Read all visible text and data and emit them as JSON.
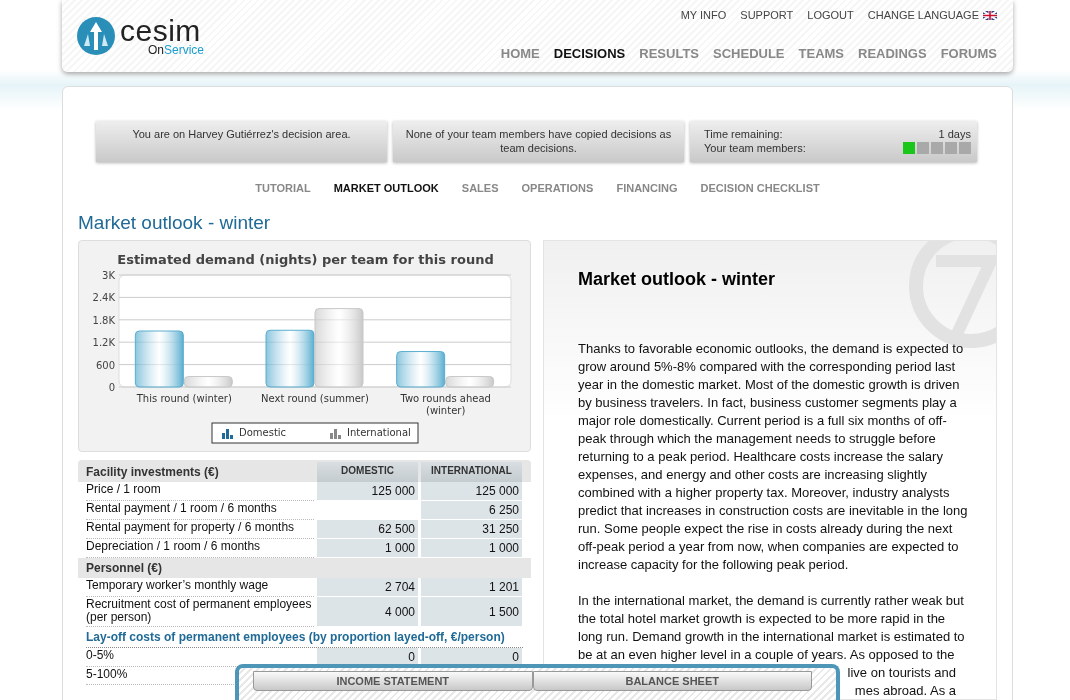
{
  "logo": {
    "name": "cesim",
    "sub_prefix": "On",
    "sub_suffix": "Service"
  },
  "top_links": [
    {
      "label": "MY INFO"
    },
    {
      "label": "SUPPORT"
    },
    {
      "label": "LOGOUT"
    },
    {
      "label": "CHANGE LANGUAGE",
      "flag": true
    }
  ],
  "main_nav": [
    {
      "label": "HOME",
      "selected": false
    },
    {
      "label": "DECISIONS",
      "selected": true
    },
    {
      "label": "RESULTS",
      "selected": false
    },
    {
      "label": "SCHEDULE",
      "selected": false
    },
    {
      "label": "TEAMS",
      "selected": false
    },
    {
      "label": "READINGS",
      "selected": false
    },
    {
      "label": "FORUMS",
      "selected": false
    }
  ],
  "info_boxes": [
    {
      "kind": "text",
      "text": "You are on Harvey Gutiérrez's decision area."
    },
    {
      "kind": "text",
      "text": "None of your team members have copied decisions as team decisions."
    },
    {
      "kind": "status",
      "time_label": "Time remaining:",
      "time_value": "1 days",
      "members_label": "Your team members:",
      "members": [
        {
          "online": true
        },
        {
          "online": false
        },
        {
          "online": false
        },
        {
          "online": false
        },
        {
          "online": false
        }
      ]
    }
  ],
  "sub_nav": [
    {
      "label": "TUTORIAL",
      "selected": false
    },
    {
      "label": "MARKET OUTLOOK",
      "selected": true
    },
    {
      "label": "SALES",
      "selected": false
    },
    {
      "label": "OPERATIONS",
      "selected": false
    },
    {
      "label": "FINANCING",
      "selected": false
    },
    {
      "label": "DECISION CHECKLIST",
      "selected": false
    }
  ],
  "page_title": "Market outlook - winter",
  "chart": {
    "chart_data": {
      "type": "bar",
      "title": "Estimated demand (nights) per team for this round",
      "categories": [
        "This round (winter)",
        "Next round (summer)",
        "Two rounds ahead (winter)"
      ],
      "series": [
        {
          "name": "Domestic",
          "color": "#5aaed0",
          "values": [
            1500,
            1520,
            950
          ]
        },
        {
          "name": "International",
          "color": "#c8c8c8",
          "values": [
            280,
            2100,
            280
          ]
        }
      ],
      "grid": true,
      "legend": true,
      "ylim": [
        0,
        3000
      ],
      "yticks": [
        {
          "value": 0,
          "label": "0"
        },
        {
          "value": 600,
          "label": "600"
        },
        {
          "value": 1200,
          "label": "1.2K"
        },
        {
          "value": 1800,
          "label": "1.8K"
        },
        {
          "value": 2400,
          "label": "2.4K"
        },
        {
          "value": 3000,
          "label": "3K"
        }
      ]
    }
  },
  "table": {
    "columns": [
      "DOMESTIC",
      "INTERNATIONAL"
    ],
    "sections": [
      {
        "kind": "group",
        "title": "Facility investments (€)",
        "header": true,
        "rows": [
          {
            "label": "Price / 1 room",
            "domestic": "125 000",
            "international": "125 000"
          },
          {
            "label": "Rental payment / 1 room / 6 months",
            "international": "6 250"
          },
          {
            "label": "Rental payment for property / 6 months",
            "domestic": "62 500",
            "international": "31 250"
          },
          {
            "label": "Depreciation / 1 room / 6 months",
            "domestic": "1 000",
            "international": "1 000"
          }
        ]
      },
      {
        "kind": "group",
        "title": "Personnel (€)",
        "rows": [
          {
            "label": "Temporary worker’s monthly wage",
            "domestic": "2 704",
            "international": "1 201"
          },
          {
            "label": "Recruitment cost of permanent employees (per person)",
            "domestic": "4 000",
            "international": "1 500"
          }
        ]
      },
      {
        "kind": "subgroup",
        "title": "Lay-off costs of permanent employees (by proportion layed-off, €/person)",
        "rows": [
          {
            "label": "0-5%",
            "domestic": "0",
            "international": "0"
          },
          {
            "label": "5-100%"
          }
        ]
      }
    ]
  },
  "article": {
    "title": "Market outlook - winter",
    "paragraphs": [
      "Thanks to favorable economic outlooks, the demand is expected to grow around 5%-8% compared with the corresponding period last year in the domestic market. Most of the domestic growth is driven by business travelers. In fact, business customer segments play a major role domestically. Current period is a full six months of off-peak through which the management needs to struggle before returning to a peak period. Healthcare costs increase the salary expenses, and energy and other costs are increasing slightly combined with a higher property tax. Moreover, industry analysts predict that increases in construction costs are inevitable in the long run. Some people expect the rise in costs already during the next off-peak period a year from now, when companies are expected to increase capacity for the following peak period.",
      "In the international market, the demand is currently rather weak but the total hotel market growth is expected to be more rapid in the long run. Demand growth in the international market is estimated to be at an even higher level in a couple of years. As opposed to the"
    ],
    "covered_lines": [
      "live on tourists and",
      "mes abroad. As a"
    ]
  },
  "bottom_tabs": [
    {
      "label": "INCOME STATEMENT"
    },
    {
      "label": "BALANCE SHEET"
    }
  ]
}
